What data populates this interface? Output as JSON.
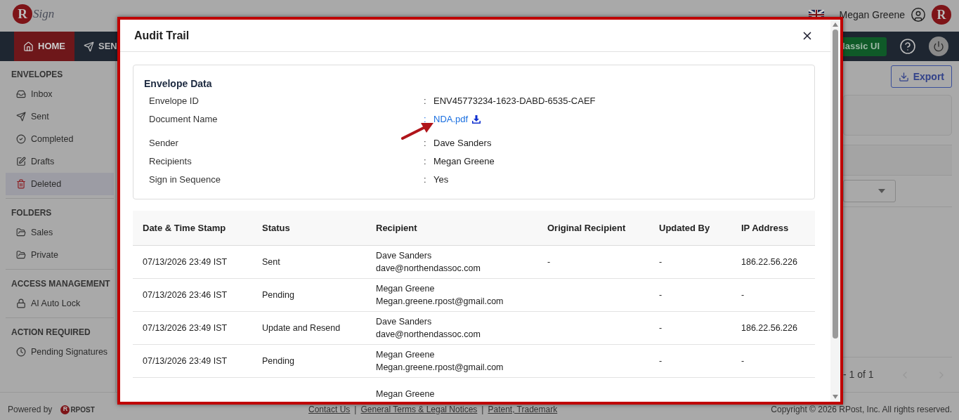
{
  "header": {
    "logo": {
      "letter": "R",
      "wordmark": "Sign"
    },
    "greeting": "Megan Greene",
    "avatar_letter": "R"
  },
  "nav": {
    "tabs": [
      {
        "label": "HOME",
        "kind": "home",
        "selected": true
      },
      {
        "label": "SEN",
        "kind": "send",
        "selected": false
      }
    ],
    "classic_button": "lassic UI"
  },
  "sidebar": {
    "sections": [
      {
        "title": "ENVELOPES",
        "items": [
          {
            "label": "Inbox",
            "kind": "inbox",
            "selected": false
          },
          {
            "label": "Sent",
            "kind": "send",
            "selected": false
          },
          {
            "label": "Completed",
            "kind": "check",
            "selected": false
          },
          {
            "label": "Drafts",
            "kind": "edit",
            "selected": false
          },
          {
            "label": "Deleted",
            "kind": "trash",
            "selected": true
          }
        ]
      },
      {
        "title": "FOLDERS",
        "items": [
          {
            "label": "Sales",
            "kind": "folder",
            "selected": false
          },
          {
            "label": "Private",
            "kind": "folder",
            "selected": false
          }
        ]
      },
      {
        "title": "ACCESS MANAGEMENT",
        "items": [
          {
            "label": "AI Auto Lock",
            "kind": "lock",
            "selected": false
          }
        ]
      },
      {
        "title": "ACTION REQUIRED",
        "items": [
          {
            "label": "Pending Signatures",
            "kind": "clock",
            "selected": false
          }
        ]
      }
    ]
  },
  "content": {
    "export_button": "Export",
    "pagination": "- 1 of 1"
  },
  "footer": {
    "powered_by": "Powered by",
    "brand": {
      "letter": "R",
      "name": "RPOST"
    },
    "links": [
      {
        "label": "Contact Us"
      },
      {
        "label": "General Terms & Legal Notices"
      },
      {
        "label": "Patent, Trademark"
      }
    ],
    "separator": "|",
    "copyright": "Copyright © 2026 RPost, Inc. All rights reserved."
  },
  "modal": {
    "title": "Audit Trail",
    "envelope_data": {
      "title": "Envelope Data",
      "fields": [
        {
          "label": "Envelope ID",
          "colon": ":",
          "value": "ENV45773234-1623-DABD-6535-CAEF",
          "kind": "text"
        },
        {
          "label": "Document Name",
          "colon": ":",
          "value": "NDA.pdf",
          "kind": "link"
        },
        {
          "label": "Sender",
          "colon": ":",
          "value": "Dave Sanders",
          "kind": "text"
        },
        {
          "label": "Recipients",
          "colon": ":",
          "value": "Megan Greene",
          "kind": "text"
        },
        {
          "label": "Sign in Sequence",
          "colon": ":",
          "value": "Yes",
          "kind": "text"
        }
      ]
    },
    "table": {
      "columns": [
        "Date & Time Stamp",
        "Status",
        "Recipient",
        "Original Recipient",
        "Updated By",
        "IP Address"
      ],
      "rows": [
        {
          "date": "07/13/2026 23:49 IST",
          "status": "Sent",
          "recipient_name": "Dave Sanders",
          "recipient_email": "dave@northendassoc.com",
          "original_recipient": "-",
          "updated_by": "-",
          "ip_address": "186.22.56.226"
        },
        {
          "date": "07/13/2026 23:46 IST",
          "status": "Pending",
          "recipient_name": "Megan Greene",
          "recipient_email": "Megan.greene.rpost@gmail.com",
          "updated_by": "-",
          "ip_address": "-"
        },
        {
          "date": "07/13/2026 23:49 IST",
          "status": "Update and Resend",
          "recipient_name": "Dave Sanders",
          "recipient_email": "dave@northendassoc.com",
          "updated_by": "-",
          "ip_address": "186.22.56.226"
        },
        {
          "date": "07/13/2026 23:49 IST",
          "status": "Pending",
          "recipient_name": "Megan Greene",
          "recipient_email": "Megan.greene.rpost@gmail.com",
          "updated_by": "-",
          "ip_address": "-"
        },
        {
          "recipient_name": "Megan Greene"
        }
      ]
    }
  }
}
